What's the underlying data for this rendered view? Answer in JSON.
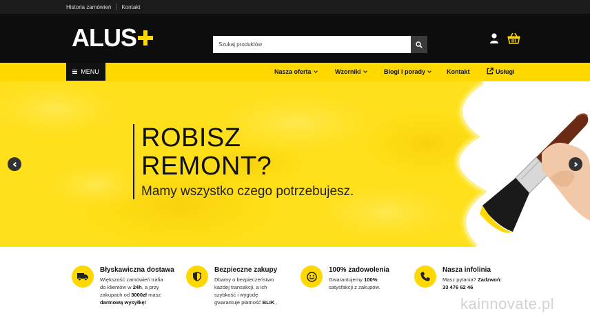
{
  "topbar": {
    "order_history": "Historia zamówień",
    "contact": "Kontakt"
  },
  "header": {
    "logo": "ALUS",
    "search_placeholder": "Szukaj produktów"
  },
  "nav": {
    "menu": "MENU",
    "items": [
      {
        "label": "Nasza oferta",
        "dropdown": true
      },
      {
        "label": "Wzorniki",
        "dropdown": true
      },
      {
        "label": "Blogi i porady",
        "dropdown": true
      },
      {
        "label": "Kontakt",
        "dropdown": false
      },
      {
        "label": "Usługi",
        "icon": "external-link-icon"
      }
    ]
  },
  "hero": {
    "title_line1": "ROBISZ",
    "title_line2": "REMONT?",
    "subtitle": "Mamy wszystko czego potrzebujesz."
  },
  "features": [
    {
      "icon": "truck-icon",
      "title": "Błyskawiczna dostawa",
      "desc": [
        "Większość zamówień trafia",
        "do klientów w ",
        "24h",
        ", a przy",
        "zakupach od ",
        "3000zł",
        " masz",
        "darmową wysyłkę!"
      ]
    },
    {
      "icon": "shield-icon",
      "title": "Bezpieczne zakupy",
      "desc": [
        "Dbamy o bezpieczeństwo",
        "każdej transakcji, a ich",
        "szybkość i wygodę",
        "gwarantuje płatność ",
        "BLIK",
        " ."
      ]
    },
    {
      "icon": "smile-icon",
      "title": "100% zadowolenia",
      "desc": [
        "Gwarantujemy ",
        "100%",
        "satysfakcji z zakupów."
      ]
    },
    {
      "icon": "phone-icon",
      "title": "Nasza infolinia",
      "desc": [
        "Masz pytania? ",
        "Zadzwoń:",
        "33 476 62 46"
      ]
    }
  ],
  "watermark": "kainnovate.pl",
  "colors": {
    "accent": "#ffd800",
    "dark": "#0d0d0d"
  }
}
